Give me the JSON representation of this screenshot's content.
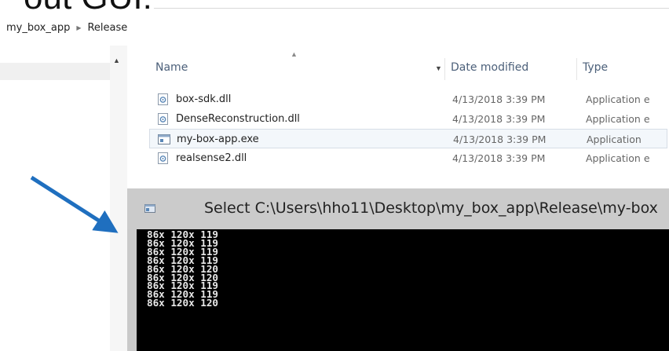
{
  "slide": {
    "title": "out GUI:"
  },
  "breadcrumb": {
    "items": [
      "my_box_app",
      "Release"
    ]
  },
  "columns": {
    "name": "Name",
    "date_modified": "Date modified",
    "type": "Type"
  },
  "files": [
    {
      "name": "box-sdk.dll",
      "date": "4/13/2018 3:39 PM",
      "type": "Application e",
      "icon": "dll-icon"
    },
    {
      "name": "DenseReconstruction.dll",
      "date": "4/13/2018 3:39 PM",
      "type": "Application e",
      "icon": "dll-icon"
    },
    {
      "name": "my-box-app.exe",
      "date": "4/13/2018 3:39 PM",
      "type": "Application",
      "icon": "exe-icon"
    },
    {
      "name": "realsense2.dll",
      "date": "4/13/2018 3:39 PM",
      "type": "Application e",
      "icon": "dll-icon"
    }
  ],
  "console": {
    "title": "Select C:\\Users\\hho11\\Desktop\\my_box_app\\Release\\my-box",
    "lines": [
      "86x 120x 119",
      "86x 120x 119",
      "86x 120x 119",
      "86x 120x 119",
      "86x 120x 120",
      "86x 120x 120",
      "86x 120x 119",
      "86x 120x 119",
      "86x 120x 120"
    ]
  },
  "colors": {
    "arrow": "#1f6fbf",
    "header_text": "#4c607a",
    "console_bg": "#000000",
    "console_text": "#e8e8e8"
  }
}
